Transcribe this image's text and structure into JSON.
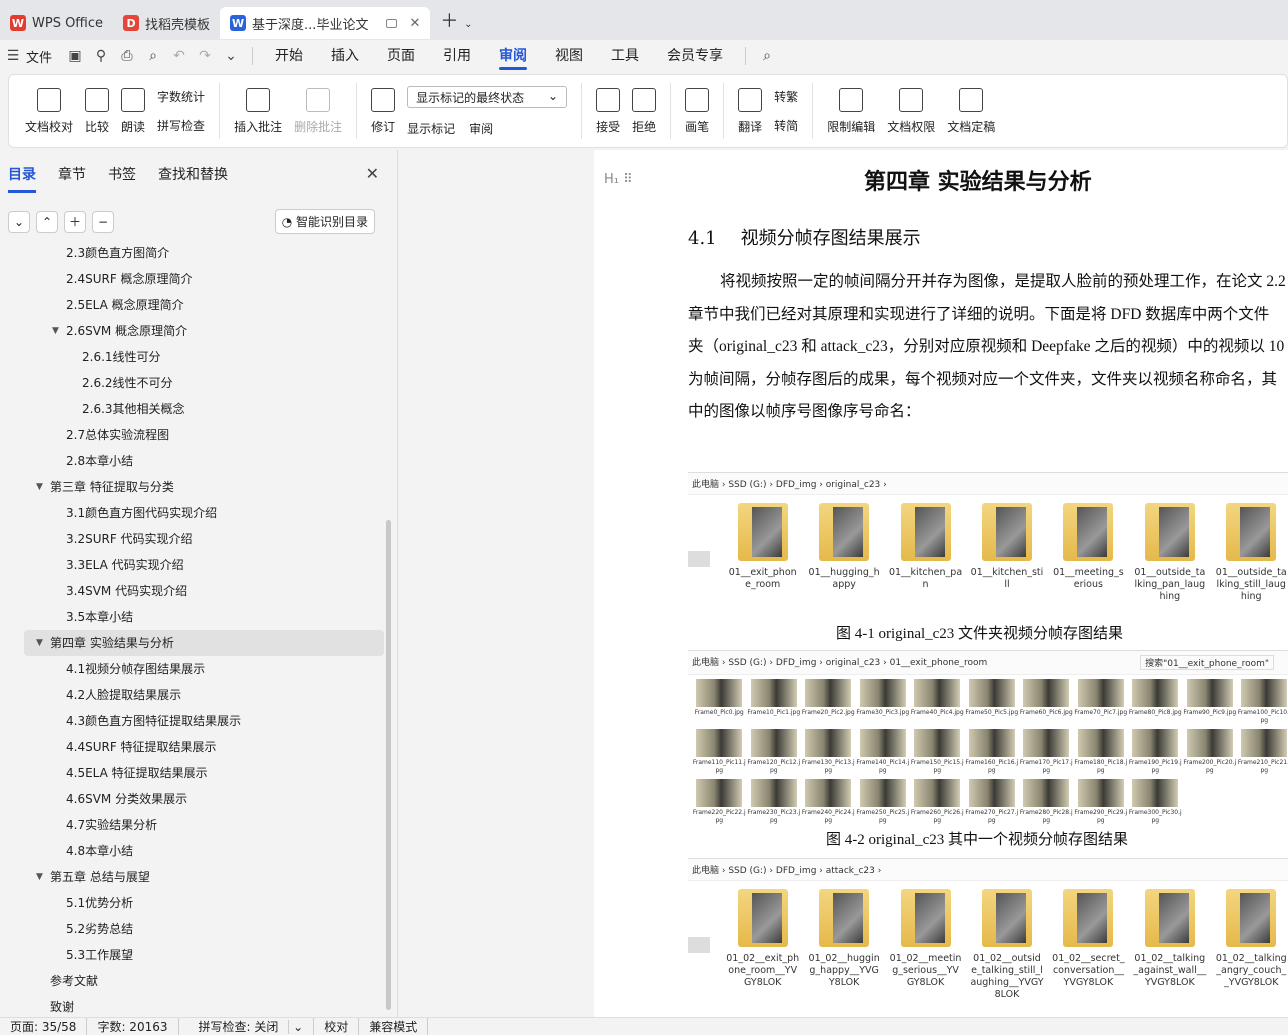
{
  "tabs": [
    {
      "label": "WPS Office"
    },
    {
      "label": "找稻壳模板"
    },
    {
      "label": "基于深度...毕业论文"
    }
  ],
  "menu": {
    "file": "文件",
    "items": [
      "开始",
      "插入",
      "页面",
      "引用",
      "审阅",
      "视图",
      "工具",
      "会员专享"
    ],
    "active": "审阅"
  },
  "ribbon": {
    "doc_check": "文档校对",
    "compare": "比较",
    "read": "朗读",
    "word_count": "字数统计",
    "spell_check": "拼写检查",
    "insert_comment": "插入批注",
    "delete_comment": "删除批注",
    "revise": "修订",
    "display_select": "显示标记的最终状态",
    "show_marks": "显示标记",
    "review": "审阅",
    "accept": "接受",
    "reject": "拒绝",
    "pen": "画笔",
    "translate": "翻译",
    "to_traditional": "转繁",
    "to_simplified": "转简",
    "restrict_edit": "限制编辑",
    "doc_permission": "文档权限",
    "finalize": "文档定稿"
  },
  "panel": {
    "tabs": [
      "目录",
      "章节",
      "书签",
      "查找和替换"
    ],
    "active": "目录",
    "smart_toc": "智能识别目录"
  },
  "toc": [
    {
      "t": "2.3颜色直方图简介",
      "lv": 2
    },
    {
      "t": "2.4SURF 概念原理简介",
      "lv": 2
    },
    {
      "t": "2.5ELA 概念原理简介",
      "lv": 2
    },
    {
      "t": "2.6SVM 概念原理简介",
      "lv": 2,
      "exp": true
    },
    {
      "t": "2.6.1线性可分",
      "lv": 3
    },
    {
      "t": "2.6.2线性不可分",
      "lv": 3
    },
    {
      "t": "2.6.3其他相关概念",
      "lv": 3
    },
    {
      "t": "2.7总体实验流程图",
      "lv": 2
    },
    {
      "t": "2.8本章小结",
      "lv": 2
    },
    {
      "t": "第三章 特征提取与分类",
      "lv": 1,
      "exp": true
    },
    {
      "t": "3.1颜色直方图代码实现介绍",
      "lv": 2
    },
    {
      "t": "3.2SURF 代码实现介绍",
      "lv": 2
    },
    {
      "t": "3.3ELA 代码实现介绍",
      "lv": 2
    },
    {
      "t": "3.4SVM 代码实现介绍",
      "lv": 2
    },
    {
      "t": "3.5本章小结",
      "lv": 2
    },
    {
      "t": "第四章 实验结果与分析",
      "lv": 1,
      "exp": true,
      "sel": true
    },
    {
      "t": "4.1视频分帧存图结果展示",
      "lv": 2
    },
    {
      "t": "4.2人脸提取结果展示",
      "lv": 2
    },
    {
      "t": "4.3颜色直方图特征提取结果展示",
      "lv": 2
    },
    {
      "t": "4.4SURF 特征提取结果展示",
      "lv": 2
    },
    {
      "t": "4.5ELA 特征提取结果展示",
      "lv": 2
    },
    {
      "t": "4.6SVM 分类效果展示",
      "lv": 2
    },
    {
      "t": "4.7实验结果分析",
      "lv": 2
    },
    {
      "t": "4.8本章小结",
      "lv": 2
    },
    {
      "t": "第五章 总结与展望",
      "lv": 1,
      "exp": true
    },
    {
      "t": "5.1优势分析",
      "lv": 2
    },
    {
      "t": "5.2劣势总结",
      "lv": 2
    },
    {
      "t": "5.3工作展望",
      "lv": 2
    },
    {
      "t": "参考文献",
      "lv": 1
    },
    {
      "t": "致谢",
      "lv": 1
    }
  ],
  "doc": {
    "chapter": "第四章  实验结果与分析",
    "sec_num": "4.1",
    "sec_title": "视频分帧存图结果展示",
    "lines": [
      "将视频按照一定的帧间隔分开并存为图像，是提取人脸前的预处理工作，在论文 2.2",
      "章节中我们已经对其原理和实现进行了详细的说明。下面是将 DFD 数据库中两个文件",
      "夹（original_c23 和 attack_c23，分别对应原视频和 Deepfake 之后的视频）中的视频以 10",
      "为帧间隔，分帧存图后的成果，每个视频对应一个文件夹，文件夹以视频名称命名，其",
      "中的图像以帧序号图像序号命名："
    ],
    "fig1": {
      "crumb": "此电脑 › SSD (G:) › DFD_img › original_c23 ›",
      "folders": [
        "01__exit_phone_room",
        "01__hugging_happy",
        "01__kitchen_pan",
        "01__kitchen_still",
        "01__meeting_serious",
        "01__outside_talking_pan_laughing",
        "01__outside_talking_still_laughing"
      ],
      "caption": "图  4-1 original_c23 文件夹视频分帧存图结果"
    },
    "fig2": {
      "crumb": "此电脑 › SSD (G:) › DFD_img › original_c23 › 01__exit_phone_room",
      "search": "搜索\"01__exit_phone_room\"",
      "frames": [
        "Frame0_Pic0.jpg",
        "Frame10_Pic1.jpg",
        "Frame20_Pic2.jpg",
        "Frame30_Pic3.jpg",
        "Frame40_Pic4.jpg",
        "Frame50_Pic5.jpg",
        "Frame60_Pic6.jpg",
        "Frame70_Pic7.jpg",
        "Frame80_Pic8.jpg",
        "Frame90_Pic9.jpg",
        "Frame100_Pic10.jpg",
        "Frame110_Pic11.jpg",
        "Frame120_Pic12.jpg",
        "Frame130_Pic13.jpg",
        "Frame140_Pic14.jpg",
        "Frame150_Pic15.jpg",
        "Frame160_Pic16.jpg",
        "Frame170_Pic17.jpg",
        "Frame180_Pic18.jpg",
        "Frame190_Pic19.jpg",
        "Frame200_Pic20.jpg",
        "Frame210_Pic21.jpg",
        "Frame220_Pic22.jpg",
        "Frame230_Pic23.jpg",
        "Frame240_Pic24.jpg",
        "Frame250_Pic25.jpg",
        "Frame260_Pic26.jpg",
        "Frame270_Pic27.jpg",
        "Frame280_Pic28.jpg",
        "Frame290_Pic29.jpg",
        "Frame300_Pic30.jpg"
      ],
      "caption": "图  4-2 original_c23 其中一个视频分帧存图结果"
    },
    "fig3": {
      "crumb": "此电脑 › SSD (G:) › DFD_img › attack_c23 ›",
      "folders": [
        "01_02__exit_phone_room__YVGY8LOK",
        "01_02__hugging_happy__YVGY8LOK",
        "01_02__meeting_serious__YVGY8LOK",
        "01_02__outside_talking_still_laughing__YVGY8LOK",
        "01_02__secret_conversation__YVGY8LOK",
        "01_02__talking_against_wall__YVGY8LOK",
        "01_02__talking_angry_couch__YVGY8LOK"
      ]
    }
  },
  "status": {
    "page": "页面: 35/58",
    "words": "字数: 20163",
    "spell": "拼写检查: 关闭",
    "proof": "校对",
    "compat": "兼容模式"
  }
}
